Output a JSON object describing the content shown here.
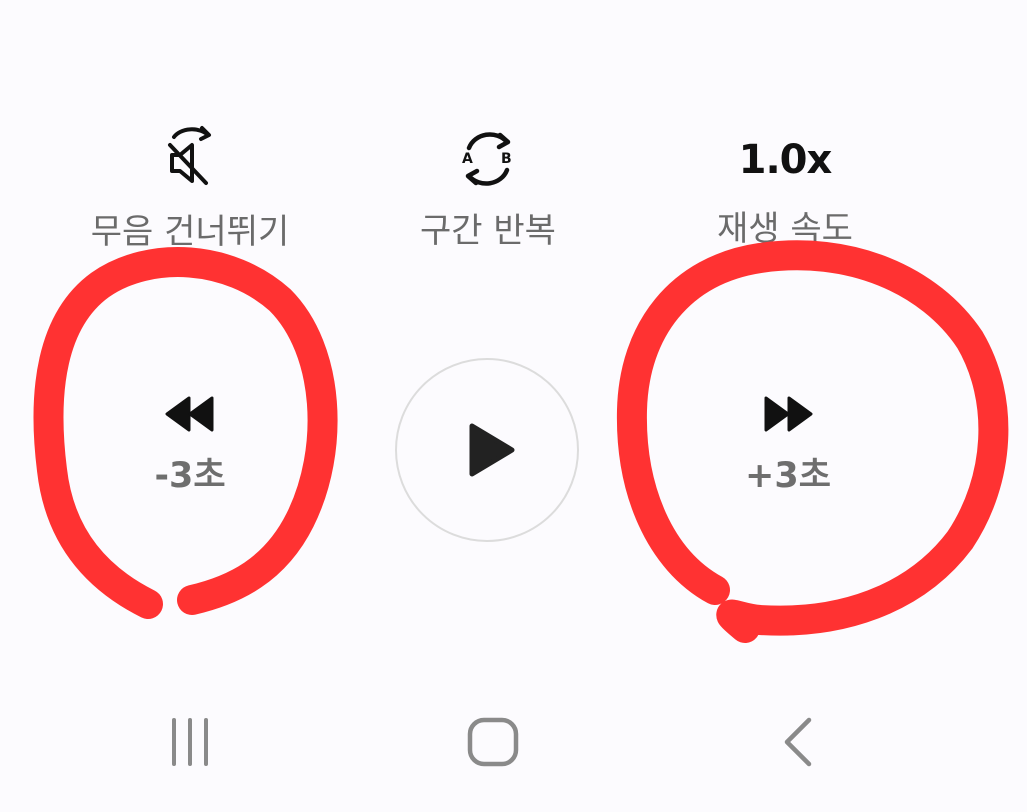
{
  "options": {
    "skip_silence_label": "무음 건너뛰기",
    "ab_repeat_label": "구간 반복",
    "ab_repeat_a": "A",
    "ab_repeat_b": "B",
    "speed_value": "1.0x",
    "speed_label": "재생 속도"
  },
  "transport": {
    "rewind_label": "-3초",
    "forward_label": "+3초"
  },
  "colors": {
    "annotation": "#ff3232",
    "icon": "#111111",
    "label": "#6b6b6b",
    "nav": "#8a8a8a"
  },
  "icons": {
    "skip_silence": "mute-skip-icon",
    "ab_repeat": "ab-repeat-icon",
    "rewind": "rewind-icon",
    "play": "play-icon",
    "forward": "fast-forward-icon",
    "nav_recents": "recent-apps-icon",
    "nav_home": "home-icon",
    "nav_back": "back-icon"
  }
}
